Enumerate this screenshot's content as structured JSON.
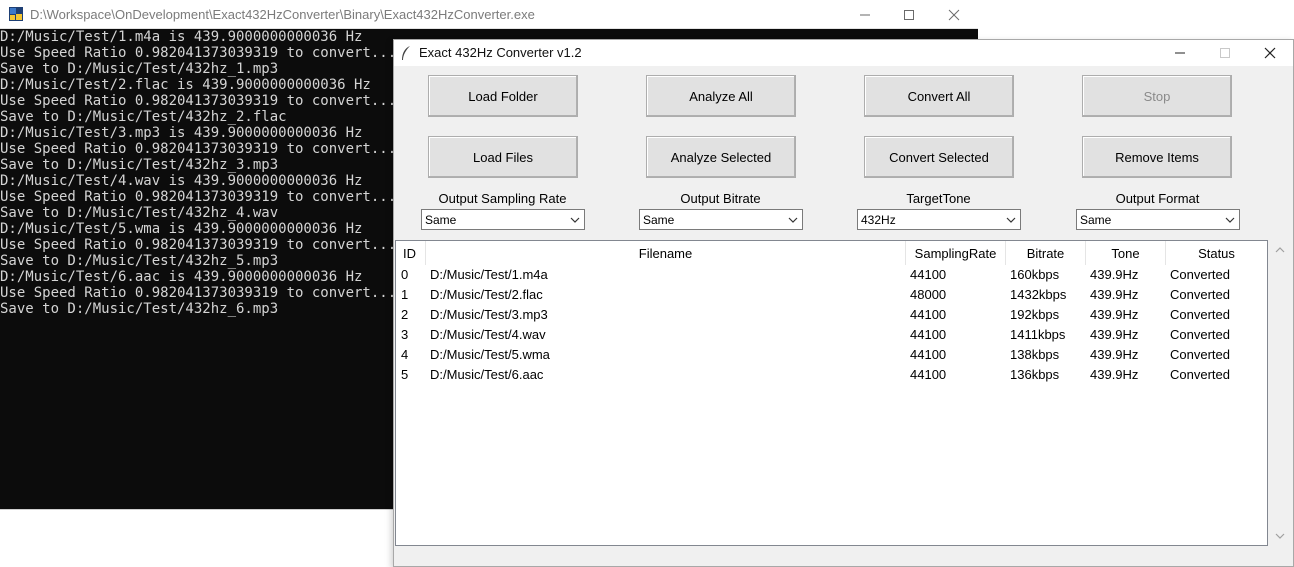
{
  "console": {
    "title": "D:\\Workspace\\OnDevelopment\\Exact432HzConverter\\Binary\\Exact432HzConverter.exe",
    "lines": [
      "D:/Music/Test/1.m4a is 439.9000000000036 Hz",
      "Use Speed Ratio 0.982041373039319 to convert...",
      "Save to D:/Music/Test/432hz_1.mp3",
      "D:/Music/Test/2.flac is 439.9000000000036 Hz",
      "Use Speed Ratio 0.982041373039319 to convert...",
      "Save to D:/Music/Test/432hz_2.flac",
      "D:/Music/Test/3.mp3 is 439.9000000000036 Hz",
      "Use Speed Ratio 0.982041373039319 to convert...",
      "Save to D:/Music/Test/432hz_3.mp3",
      "D:/Music/Test/4.wav is 439.9000000000036 Hz",
      "Use Speed Ratio 0.982041373039319 to convert...",
      "Save to D:/Music/Test/432hz_4.wav",
      "D:/Music/Test/5.wma is 439.9000000000036 Hz",
      "Use Speed Ratio 0.982041373039319 to convert...",
      "Save to D:/Music/Test/432hz_5.mp3",
      "D:/Music/Test/6.aac is 439.9000000000036 Hz",
      "Use Speed Ratio 0.982041373039319 to convert...",
      "Save to D:/Music/Test/432hz_6.mp3"
    ]
  },
  "main": {
    "title": "Exact 432Hz Converter v1.2",
    "buttons": {
      "load_folder": "Load Folder",
      "analyze_all": "Analyze All",
      "convert_all": "Convert All",
      "stop": "Stop",
      "load_files": "Load Files",
      "analyze_selected": "Analyze Selected",
      "convert_selected": "Convert Selected",
      "remove_items": "Remove Items"
    },
    "options": {
      "sampling_rate": {
        "label": "Output Sampling Rate",
        "value": "Same"
      },
      "bitrate": {
        "label": "Output Bitrate",
        "value": "Same"
      },
      "target_tone": {
        "label": "TargetTone",
        "value": "432Hz"
      },
      "format": {
        "label": "Output Format",
        "value": "Same"
      }
    },
    "table": {
      "columns": [
        "ID",
        "Filename",
        "SamplingRate",
        "Bitrate",
        "Tone",
        "Status"
      ],
      "rows": [
        [
          "0",
          "D:/Music/Test/1.m4a",
          "44100",
          "160kbps",
          "439.9Hz",
          "Converted"
        ],
        [
          "1",
          "D:/Music/Test/2.flac",
          "48000",
          "1432kbps",
          "439.9Hz",
          "Converted"
        ],
        [
          "2",
          "D:/Music/Test/3.mp3",
          "44100",
          "192kbps",
          "439.9Hz",
          "Converted"
        ],
        [
          "3",
          "D:/Music/Test/4.wav",
          "44100",
          "1411kbps",
          "439.9Hz",
          "Converted"
        ],
        [
          "4",
          "D:/Music/Test/5.wma",
          "44100",
          "138kbps",
          "439.9Hz",
          "Converted"
        ],
        [
          "5",
          "D:/Music/Test/6.aac",
          "44100",
          "136kbps",
          "439.9Hz",
          "Converted"
        ]
      ]
    }
  },
  "icons": {
    "console_app": "python-icon",
    "main_app": "feather-icon",
    "minimize": "minimize-icon",
    "maximize": "maximize-icon",
    "close": "close-icon",
    "dropdown": "chevron-down-icon"
  }
}
